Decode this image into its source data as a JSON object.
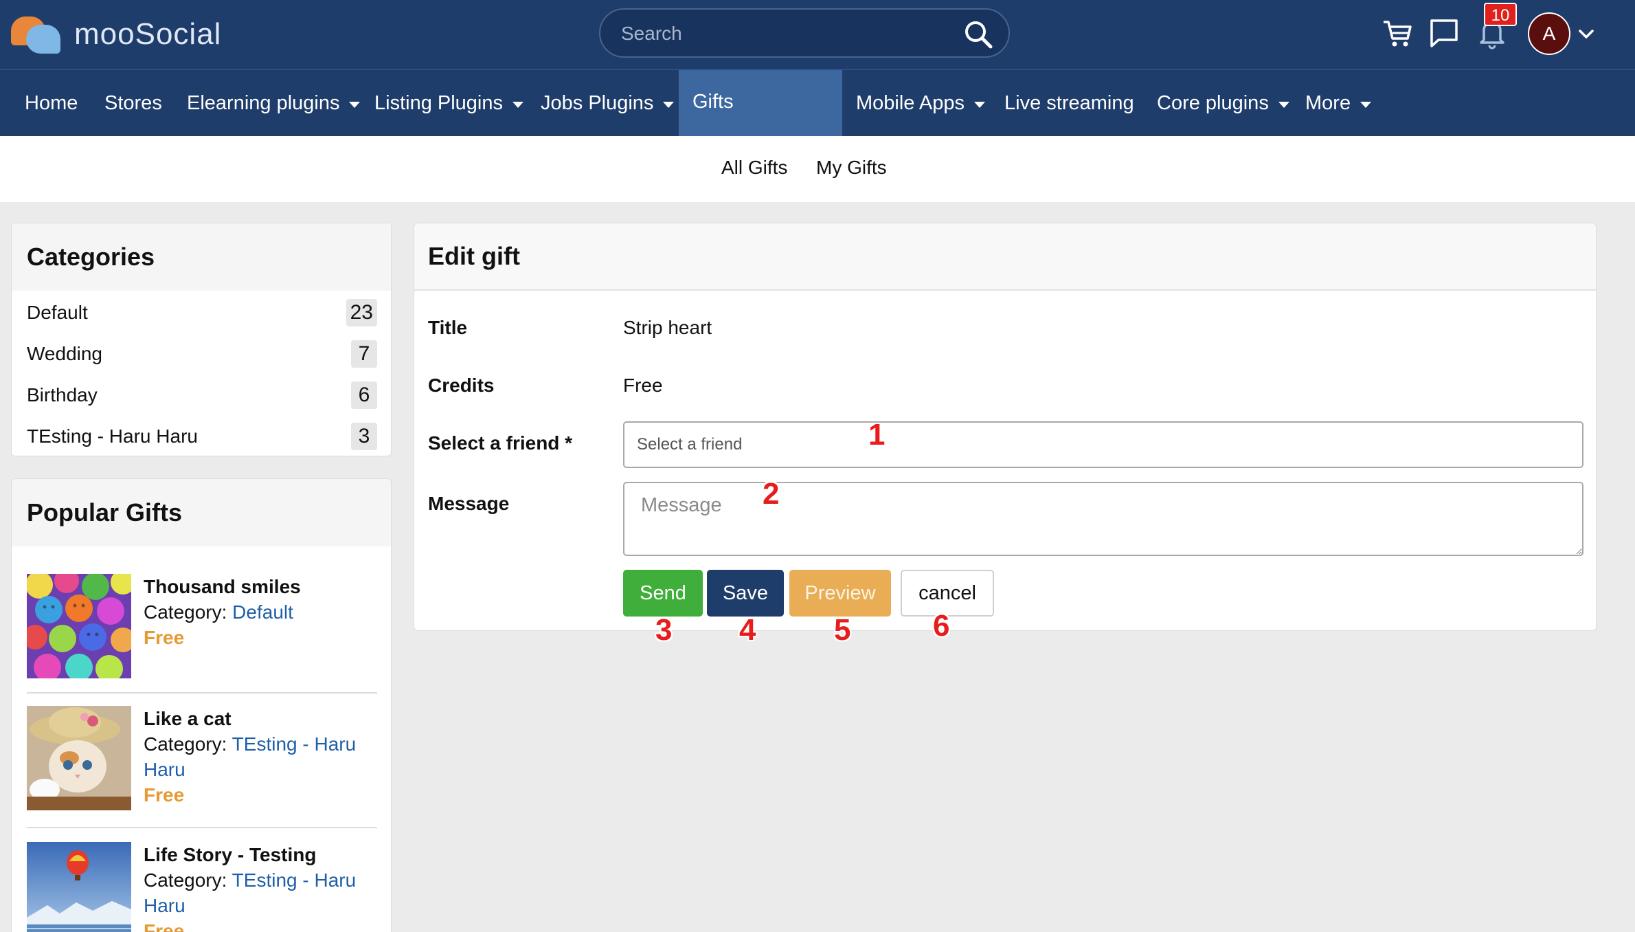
{
  "header": {
    "logo_text": "mooSocial",
    "search_placeholder": "Search",
    "notification_count": "10",
    "avatar_initial": "A"
  },
  "nav": {
    "items": [
      {
        "label": "Home",
        "dropdown": false
      },
      {
        "label": "Stores",
        "dropdown": false
      },
      {
        "label": "Elearning plugins",
        "dropdown": true
      },
      {
        "label": "Listing Plugins",
        "dropdown": true
      },
      {
        "label": "Jobs Plugins",
        "dropdown": true
      },
      {
        "label": "Gifts",
        "dropdown": false,
        "active": true
      },
      {
        "label": "Mobile Apps",
        "dropdown": true
      },
      {
        "label": "Live streaming",
        "dropdown": false
      },
      {
        "label": "Core plugins",
        "dropdown": true
      },
      {
        "label": "More",
        "dropdown": true
      }
    ]
  },
  "subnav": {
    "all_gifts": "All Gifts",
    "my_gifts": "My Gifts"
  },
  "categories": {
    "title": "Categories",
    "items": [
      {
        "name": "Default",
        "count": "23"
      },
      {
        "name": "Wedding",
        "count": "7"
      },
      {
        "name": "Birthday",
        "count": "6"
      },
      {
        "name": "TEsting - Haru Haru",
        "count": "3"
      }
    ]
  },
  "popular": {
    "title": "Popular Gifts",
    "category_prefix": "Category: ",
    "items": [
      {
        "title": "Thousand smiles",
        "category": "Default",
        "price": "Free"
      },
      {
        "title": "Like a cat",
        "category": "TEsting - Haru Haru",
        "price": "Free"
      },
      {
        "title": "Life Story - Testing",
        "category": "TEsting - Haru Haru",
        "price": "Free"
      }
    ]
  },
  "form": {
    "heading": "Edit gift",
    "title_label": "Title",
    "title_value": "Strip heart",
    "credits_label": "Credits",
    "credits_value": "Free",
    "friend_label": "Select a friend *",
    "friend_placeholder": "Select a friend",
    "message_label": "Message",
    "message_placeholder": "Message",
    "buttons": {
      "send": "Send",
      "save": "Save",
      "preview": "Preview",
      "cancel": "cancel"
    }
  },
  "annotations": [
    "1",
    "2",
    "3",
    "4",
    "5",
    "6"
  ],
  "colors": {
    "header_bg": "#1f3d6b",
    "active_nav": "#3d679f",
    "send": "#3fae3a",
    "save": "#1f3d6b",
    "preview": "#e8ad55",
    "price": "#e59a32",
    "link": "#1f5ea8",
    "annotation": "#e81c1c"
  }
}
